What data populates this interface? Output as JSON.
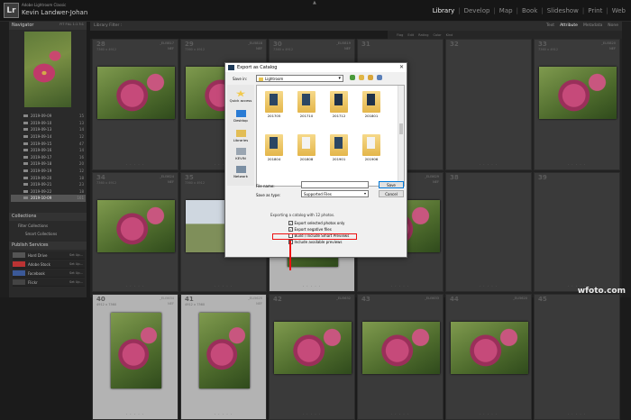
{
  "top": {
    "logo": "Lr",
    "brand": "Adobe Lightroom Classic",
    "user": "Kevin Landwer-Johan",
    "modules": [
      "Library",
      "Develop",
      "Map",
      "Book",
      "Slideshow",
      "Print",
      "Web"
    ],
    "active_module": "Library"
  },
  "left": {
    "navigator": {
      "title": "Navigator",
      "zoom": "FIT  FILL  1:1  3:1"
    },
    "folders": [
      {
        "name": "2019-09-09",
        "count": "15"
      },
      {
        "name": "2019-09-10",
        "count": "13"
      },
      {
        "name": "2019-09-13",
        "count": "14"
      },
      {
        "name": "2019-09-14",
        "count": "12"
      },
      {
        "name": "2019-09-15",
        "count": "47"
      },
      {
        "name": "2019-09-16",
        "count": "14"
      },
      {
        "name": "2019-09-17",
        "count": "16"
      },
      {
        "name": "2019-09-18",
        "count": "20"
      },
      {
        "name": "2019-09-19",
        "count": "12"
      },
      {
        "name": "2019-09-20",
        "count": "18"
      },
      {
        "name": "2019-09-21",
        "count": "23"
      },
      {
        "name": "2019-09-22",
        "count": "18"
      },
      {
        "name": "2019-10-09",
        "count": "161"
      }
    ],
    "collections": {
      "title": "Collections",
      "items": [
        "Filter Collections",
        "Smart Collections"
      ]
    },
    "publish": {
      "title": "Publish Services",
      "items": [
        {
          "name": "Hard Drive",
          "action": "Set Up..."
        },
        {
          "name": "Adobe Stock",
          "action": "Set Up..."
        },
        {
          "name": "Facebook",
          "action": "Set Up..."
        },
        {
          "name": "Flickr",
          "action": "Set Up..."
        }
      ]
    }
  },
  "filter": {
    "title": "Library Filter :",
    "modes": [
      "Text",
      "Attribute",
      "Metadata",
      "None"
    ],
    "active": "Attribute",
    "bar": [
      "Flag",
      "Edit",
      "Rating",
      "Color",
      "Kind"
    ]
  },
  "grid": {
    "cells": [
      {
        "num": "28",
        "dim": "7360 x 4912",
        "fn": "_ELI5817",
        "tag": "NEF"
      },
      {
        "num": "29",
        "dim": "7360 x 4912",
        "fn": "_ELI5818",
        "tag": "NEF"
      },
      {
        "num": "30",
        "dim": "7360 x 4912",
        "fn": "_ELI5819",
        "tag": "NEF"
      },
      {
        "num": "31",
        "dim": "",
        "fn": "",
        "tag": ""
      },
      {
        "num": "32",
        "dim": "",
        "fn": "",
        "tag": ""
      },
      {
        "num": "33",
        "dim": "7360 x 4912",
        "fn": "_ELI5820",
        "tag": "NEF"
      },
      {
        "num": "34",
        "dim": "7360 x 4912",
        "fn": "_ELI5624",
        "tag": "NEF"
      },
      {
        "num": "35",
        "dim": "7360 x 4912",
        "fn": "_ELI5627",
        "tag": "NEF"
      },
      {
        "num": "36",
        "dim": "4912 x 7360",
        "fn": "_ELI5623",
        "tag": "NEF"
      },
      {
        "num": "37",
        "dim": "7360 x 4912",
        "fn": "_ELI5629",
        "tag": "NEF"
      },
      {
        "num": "38",
        "dim": "",
        "fn": "",
        "tag": ""
      },
      {
        "num": "39",
        "dim": "",
        "fn": "",
        "tag": ""
      },
      {
        "num": "40",
        "dim": "4912 x 7360",
        "fn": "_ELI5634",
        "tag": "NEF"
      },
      {
        "num": "41",
        "dim": "4912 x 7360",
        "fn": "_ELI5625",
        "tag": "NEF"
      },
      {
        "num": "42",
        "dim": "",
        "fn": "_ELI5632",
        "tag": ""
      },
      {
        "num": "43",
        "dim": "",
        "fn": "_ELI5633",
        "tag": ""
      },
      {
        "num": "44",
        "dim": "",
        "fn": "_ELI5620",
        "tag": ""
      },
      {
        "num": "45",
        "dim": "",
        "fn": "",
        "tag": ""
      },
      {
        "num": "46",
        "dim": "",
        "fn": "",
        "tag": ""
      },
      {
        "num": "47",
        "dim": "",
        "fn": "_ELI5625",
        "tag": ""
      },
      {
        "num": "48",
        "dim": "",
        "fn": "_ELI5631",
        "tag": ""
      }
    ],
    "stars": "· · · · ·"
  },
  "dialog": {
    "title": "Export as Catalog",
    "save_in_label": "Save in:",
    "save_in_value": "Lightroom",
    "places": [
      "Quick access",
      "Desktop",
      "Libraries",
      "KEVIN",
      "Network"
    ],
    "files": [
      "201705",
      "201710",
      "201712",
      "201801",
      "201804",
      "201808",
      "201901",
      "201906"
    ],
    "file_name_label": "File name:",
    "file_name_value": "",
    "save_as_type_label": "Save as type:",
    "save_as_type_value": "Supported Files",
    "save_button": "Save",
    "cancel_button": "Cancel",
    "info": "Exporting a catalog with 12 photos.",
    "options": [
      {
        "label": "Export selected photos only",
        "checked": true
      },
      {
        "label": "Export negative files",
        "checked": true
      },
      {
        "label": "Build / Include Smart Previews",
        "checked": false
      },
      {
        "label": "Include available previews",
        "checked": false
      }
    ]
  },
  "watermark": "wfoto.com"
}
